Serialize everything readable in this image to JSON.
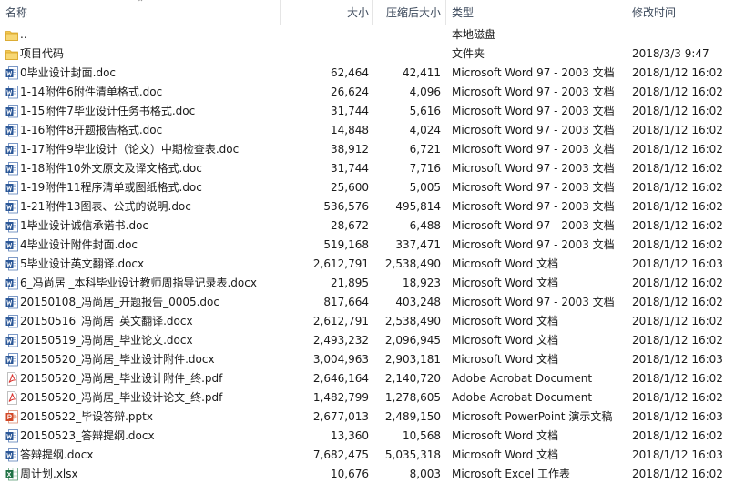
{
  "header": {
    "name": "名称",
    "size": "大小",
    "compressed": "压缩后大小",
    "type": "类型",
    "modified": "修改时间"
  },
  "rows": [
    {
      "icon": "folder-icon",
      "name": "..",
      "size": "",
      "compressed": "",
      "type": "本地磁盘",
      "modified": ""
    },
    {
      "icon": "folder-icon",
      "name": "项目代码",
      "size": "",
      "compressed": "",
      "type": "文件夹",
      "modified": "2018/3/3 9:47"
    },
    {
      "icon": "word-icon",
      "name": "0毕业设计封面.doc",
      "size": "62,464",
      "compressed": "42,411",
      "type": "Microsoft Word 97 - 2003 文档",
      "modified": "2018/1/12 16:02"
    },
    {
      "icon": "word-icon",
      "name": "1-14附件6附件清单格式.doc",
      "size": "26,624",
      "compressed": "4,096",
      "type": "Microsoft Word 97 - 2003 文档",
      "modified": "2018/1/12 16:02"
    },
    {
      "icon": "word-icon",
      "name": "1-15附件7毕业设计任务书格式.doc",
      "size": "31,744",
      "compressed": "5,616",
      "type": "Microsoft Word 97 - 2003 文档",
      "modified": "2018/1/12 16:02"
    },
    {
      "icon": "word-icon",
      "name": "1-16附件8开题报告格式.doc",
      "size": "14,848",
      "compressed": "4,024",
      "type": "Microsoft Word 97 - 2003 文档",
      "modified": "2018/1/12 16:02"
    },
    {
      "icon": "word-icon",
      "name": "1-17附件9毕业设计（论文）中期检查表.doc",
      "size": "38,912",
      "compressed": "6,721",
      "type": "Microsoft Word 97 - 2003 文档",
      "modified": "2018/1/12 16:02"
    },
    {
      "icon": "word-icon",
      "name": "1-18附件10外文原文及译文格式.doc",
      "size": "31,744",
      "compressed": "7,716",
      "type": "Microsoft Word 97 - 2003 文档",
      "modified": "2018/1/12 16:02"
    },
    {
      "icon": "word-icon",
      "name": "1-19附件11程序清单或图纸格式.doc",
      "size": "25,600",
      "compressed": "5,005",
      "type": "Microsoft Word 97 - 2003 文档",
      "modified": "2018/1/12 16:02"
    },
    {
      "icon": "word-icon",
      "name": "1-21附件13图表、公式的说明.doc",
      "size": "536,576",
      "compressed": "495,814",
      "type": "Microsoft Word 97 - 2003 文档",
      "modified": "2018/1/12 16:02"
    },
    {
      "icon": "word-icon",
      "name": "1毕业设计诚信承诺书.doc",
      "size": "28,672",
      "compressed": "6,488",
      "type": "Microsoft Word 97 - 2003 文档",
      "modified": "2018/1/12 16:02"
    },
    {
      "icon": "word-icon",
      "name": "4毕业设计附件封面.doc",
      "size": "519,168",
      "compressed": "337,471",
      "type": "Microsoft Word 97 - 2003 文档",
      "modified": "2018/1/12 16:02"
    },
    {
      "icon": "word-icon",
      "name": "5毕业设计英文翻译.docx",
      "size": "2,612,791",
      "compressed": "2,538,490",
      "type": "Microsoft Word 文档",
      "modified": "2018/1/12 16:03"
    },
    {
      "icon": "word-icon",
      "name": "6_冯尚居 _本科毕业设计教师周指导记录表.docx",
      "size": "21,895",
      "compressed": "18,923",
      "type": "Microsoft Word 文档",
      "modified": "2018/1/12 16:02"
    },
    {
      "icon": "word-icon",
      "name": "20150108_冯尚居_开题报告_0005.doc",
      "size": "817,664",
      "compressed": "403,248",
      "type": "Microsoft Word 97 - 2003 文档",
      "modified": "2018/1/12 16:02"
    },
    {
      "icon": "word-icon",
      "name": "20150516_冯尚居_英文翻译.docx",
      "size": "2,612,791",
      "compressed": "2,538,490",
      "type": "Microsoft Word 文档",
      "modified": "2018/1/12 16:02"
    },
    {
      "icon": "word-icon",
      "name": "20150519_冯尚居_毕业论文.docx",
      "size": "2,493,232",
      "compressed": "2,096,945",
      "type": "Microsoft Word 文档",
      "modified": "2018/1/12 16:02"
    },
    {
      "icon": "word-icon",
      "name": "20150520_冯尚居_毕业设计附件.docx",
      "size": "3,004,963",
      "compressed": "2,903,181",
      "type": "Microsoft Word 文档",
      "modified": "2018/1/12 16:03"
    },
    {
      "icon": "pdf-icon",
      "name": "20150520_冯尚居_毕业设计附件_终.pdf",
      "size": "2,646,164",
      "compressed": "2,140,720",
      "type": "Adobe Acrobat Document",
      "modified": "2018/1/12 16:02"
    },
    {
      "icon": "pdf-icon",
      "name": "20150520_冯尚居_毕业设计论文_终.pdf",
      "size": "1,482,799",
      "compressed": "1,278,605",
      "type": "Adobe Acrobat Document",
      "modified": "2018/1/12 16:02"
    },
    {
      "icon": "powerpoint-icon",
      "name": "20150522_毕设答辩.pptx",
      "size": "2,677,013",
      "compressed": "2,489,150",
      "type": "Microsoft PowerPoint 演示文稿",
      "modified": "2018/1/12 16:03"
    },
    {
      "icon": "word-icon",
      "name": "20150523_答辩提纲.docx",
      "size": "13,360",
      "compressed": "10,568",
      "type": "Microsoft Word 文档",
      "modified": "2018/1/12 16:02"
    },
    {
      "icon": "word-icon",
      "name": "答辩提纲.docx",
      "size": "7,682,475",
      "compressed": "5,035,318",
      "type": "Microsoft Word 文档",
      "modified": "2018/1/12 16:03"
    },
    {
      "icon": "excel-icon",
      "name": "周计划.xlsx",
      "size": "10,676",
      "compressed": "8,003",
      "type": "Microsoft Excel 工作表",
      "modified": "2018/1/12 16:02"
    }
  ],
  "colors": {
    "folder": "#f3c74f",
    "word": "#2b5797",
    "pdf": "#d9302c",
    "powerpoint": "#d24726",
    "excel": "#217346"
  }
}
